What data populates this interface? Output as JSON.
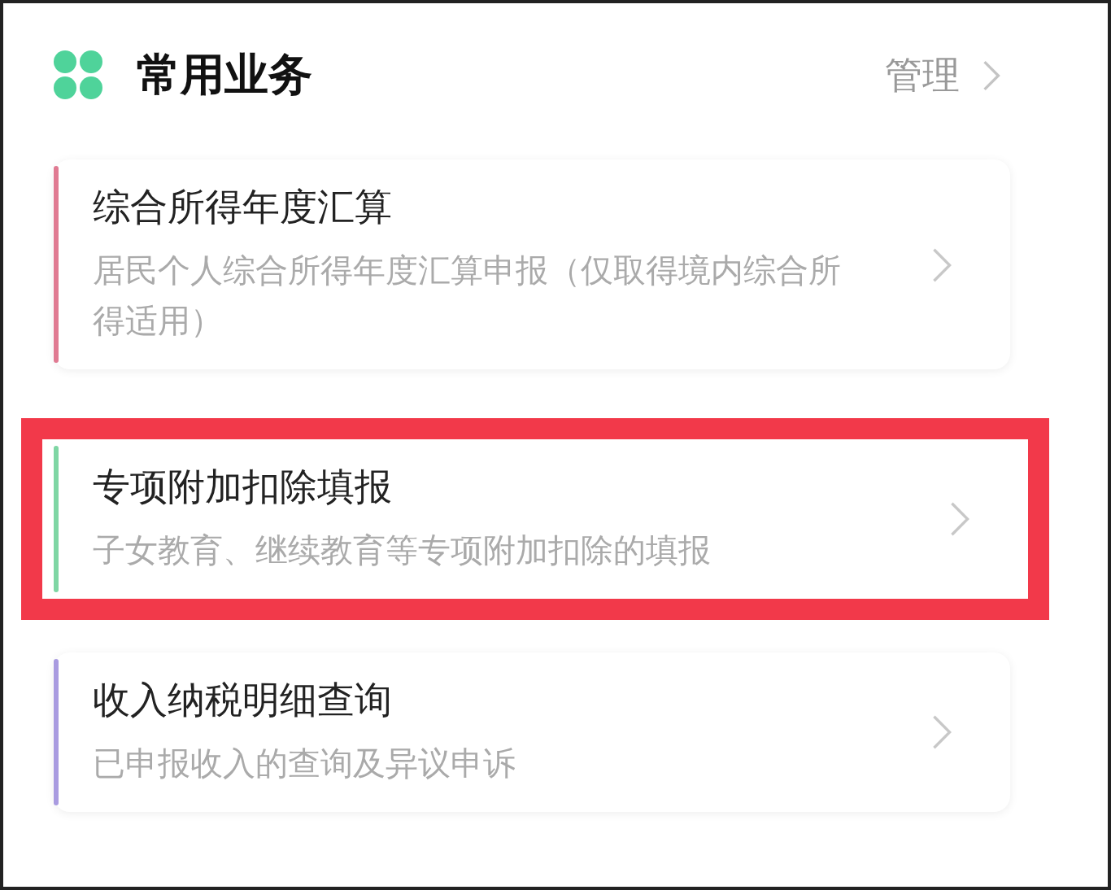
{
  "header": {
    "title": "常用业务",
    "action": "管理"
  },
  "items": [
    {
      "title": "综合所得年度汇算",
      "subtitle": "居民个人综合所得年度汇算申报（仅取得境内综合所得适用）",
      "color": "#e07a92",
      "highlighted": false
    },
    {
      "title": "专项附加扣除填报",
      "subtitle": "子女教育、继续教育等专项附加扣除的填报",
      "color": "#7fd6a4",
      "highlighted": true
    },
    {
      "title": "收入纳税明细查询",
      "subtitle": "已申报收入的查询及异议申诉",
      "color": "#a99be0",
      "highlighted": false
    }
  ]
}
